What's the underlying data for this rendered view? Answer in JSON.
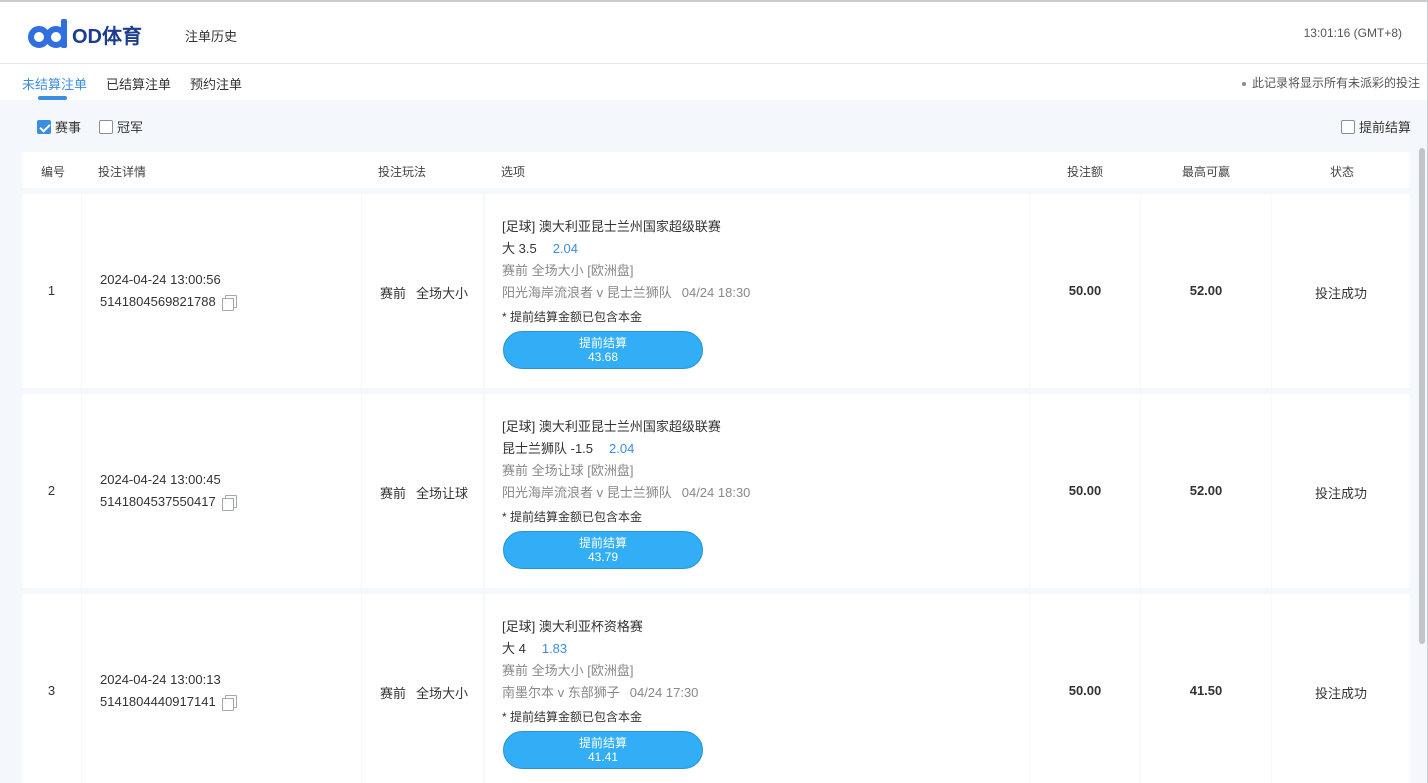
{
  "header": {
    "brand": "OD体育",
    "history_link": "注单历史",
    "clock": "13:01:16 (GMT+8)"
  },
  "tabs": {
    "items": [
      {
        "label": "未结算注单",
        "active": true
      },
      {
        "label": "已结算注单",
        "active": false
      },
      {
        "label": "预约注单",
        "active": false
      }
    ],
    "note": "此记录将显示所有未派彩的投注"
  },
  "filters": {
    "events": {
      "label": "赛事",
      "checked": true
    },
    "outright": {
      "label": "冠军",
      "checked": false
    },
    "cashout": {
      "label": "提前结算",
      "checked": false
    }
  },
  "table": {
    "columns": {
      "no": "编号",
      "details": "投注详情",
      "play": "投注玩法",
      "option": "选项",
      "stake": "投注额",
      "max_win": "最高可赢",
      "status": "状态"
    },
    "rows": [
      {
        "no": "1",
        "time": "2024-04-24 13:00:56",
        "id": "5141804569821788",
        "play_stage": "赛前",
        "play_type": "全场大小",
        "league": "[足球] 澳大利亚昆士兰州国家超级联赛",
        "pick": "大 3.5",
        "odds": "2.04",
        "market": "赛前 全场大小 [欧洲盘]",
        "match": "阳光海岸流浪者 v 昆士兰狮队",
        "match_time": "04/24 18:30",
        "note": "* 提前结算金额已包含本金",
        "cashout_label": "提前结算",
        "cashout_value": "43.68",
        "stake": "50.00",
        "max_win": "52.00",
        "status": "投注成功"
      },
      {
        "no": "2",
        "time": "2024-04-24 13:00:45",
        "id": "5141804537550417",
        "play_stage": "赛前",
        "play_type": "全场让球",
        "league": "[足球] 澳大利亚昆士兰州国家超级联赛",
        "pick": "昆士兰狮队 -1.5",
        "odds": "2.04",
        "market": "赛前 全场让球 [欧洲盘]",
        "match": "阳光海岸流浪者 v 昆士兰狮队",
        "match_time": "04/24 18:30",
        "note": "* 提前结算金额已包含本金",
        "cashout_label": "提前结算",
        "cashout_value": "43.79",
        "stake": "50.00",
        "max_win": "52.00",
        "status": "投注成功"
      },
      {
        "no": "3",
        "time": "2024-04-24 13:00:13",
        "id": "5141804440917141",
        "play_stage": "赛前",
        "play_type": "全场大小",
        "league": "[足球] 澳大利亚杯资格赛",
        "pick": "大 4",
        "odds": "1.83",
        "market": "赛前 全场大小 [欧洲盘]",
        "match": "南墨尔本 v 东部狮子",
        "match_time": "04/24 17:30",
        "note": "* 提前结算金额已包含本金",
        "cashout_label": "提前结算",
        "cashout_value": "41.41",
        "stake": "50.00",
        "max_win": "41.50",
        "status": "投注成功"
      }
    ]
  },
  "colors": {
    "accent": "#3a8de0",
    "cashout_button": "#31aef5",
    "page_bg": "#f4f7fb",
    "brand": "#2f6fe0"
  }
}
